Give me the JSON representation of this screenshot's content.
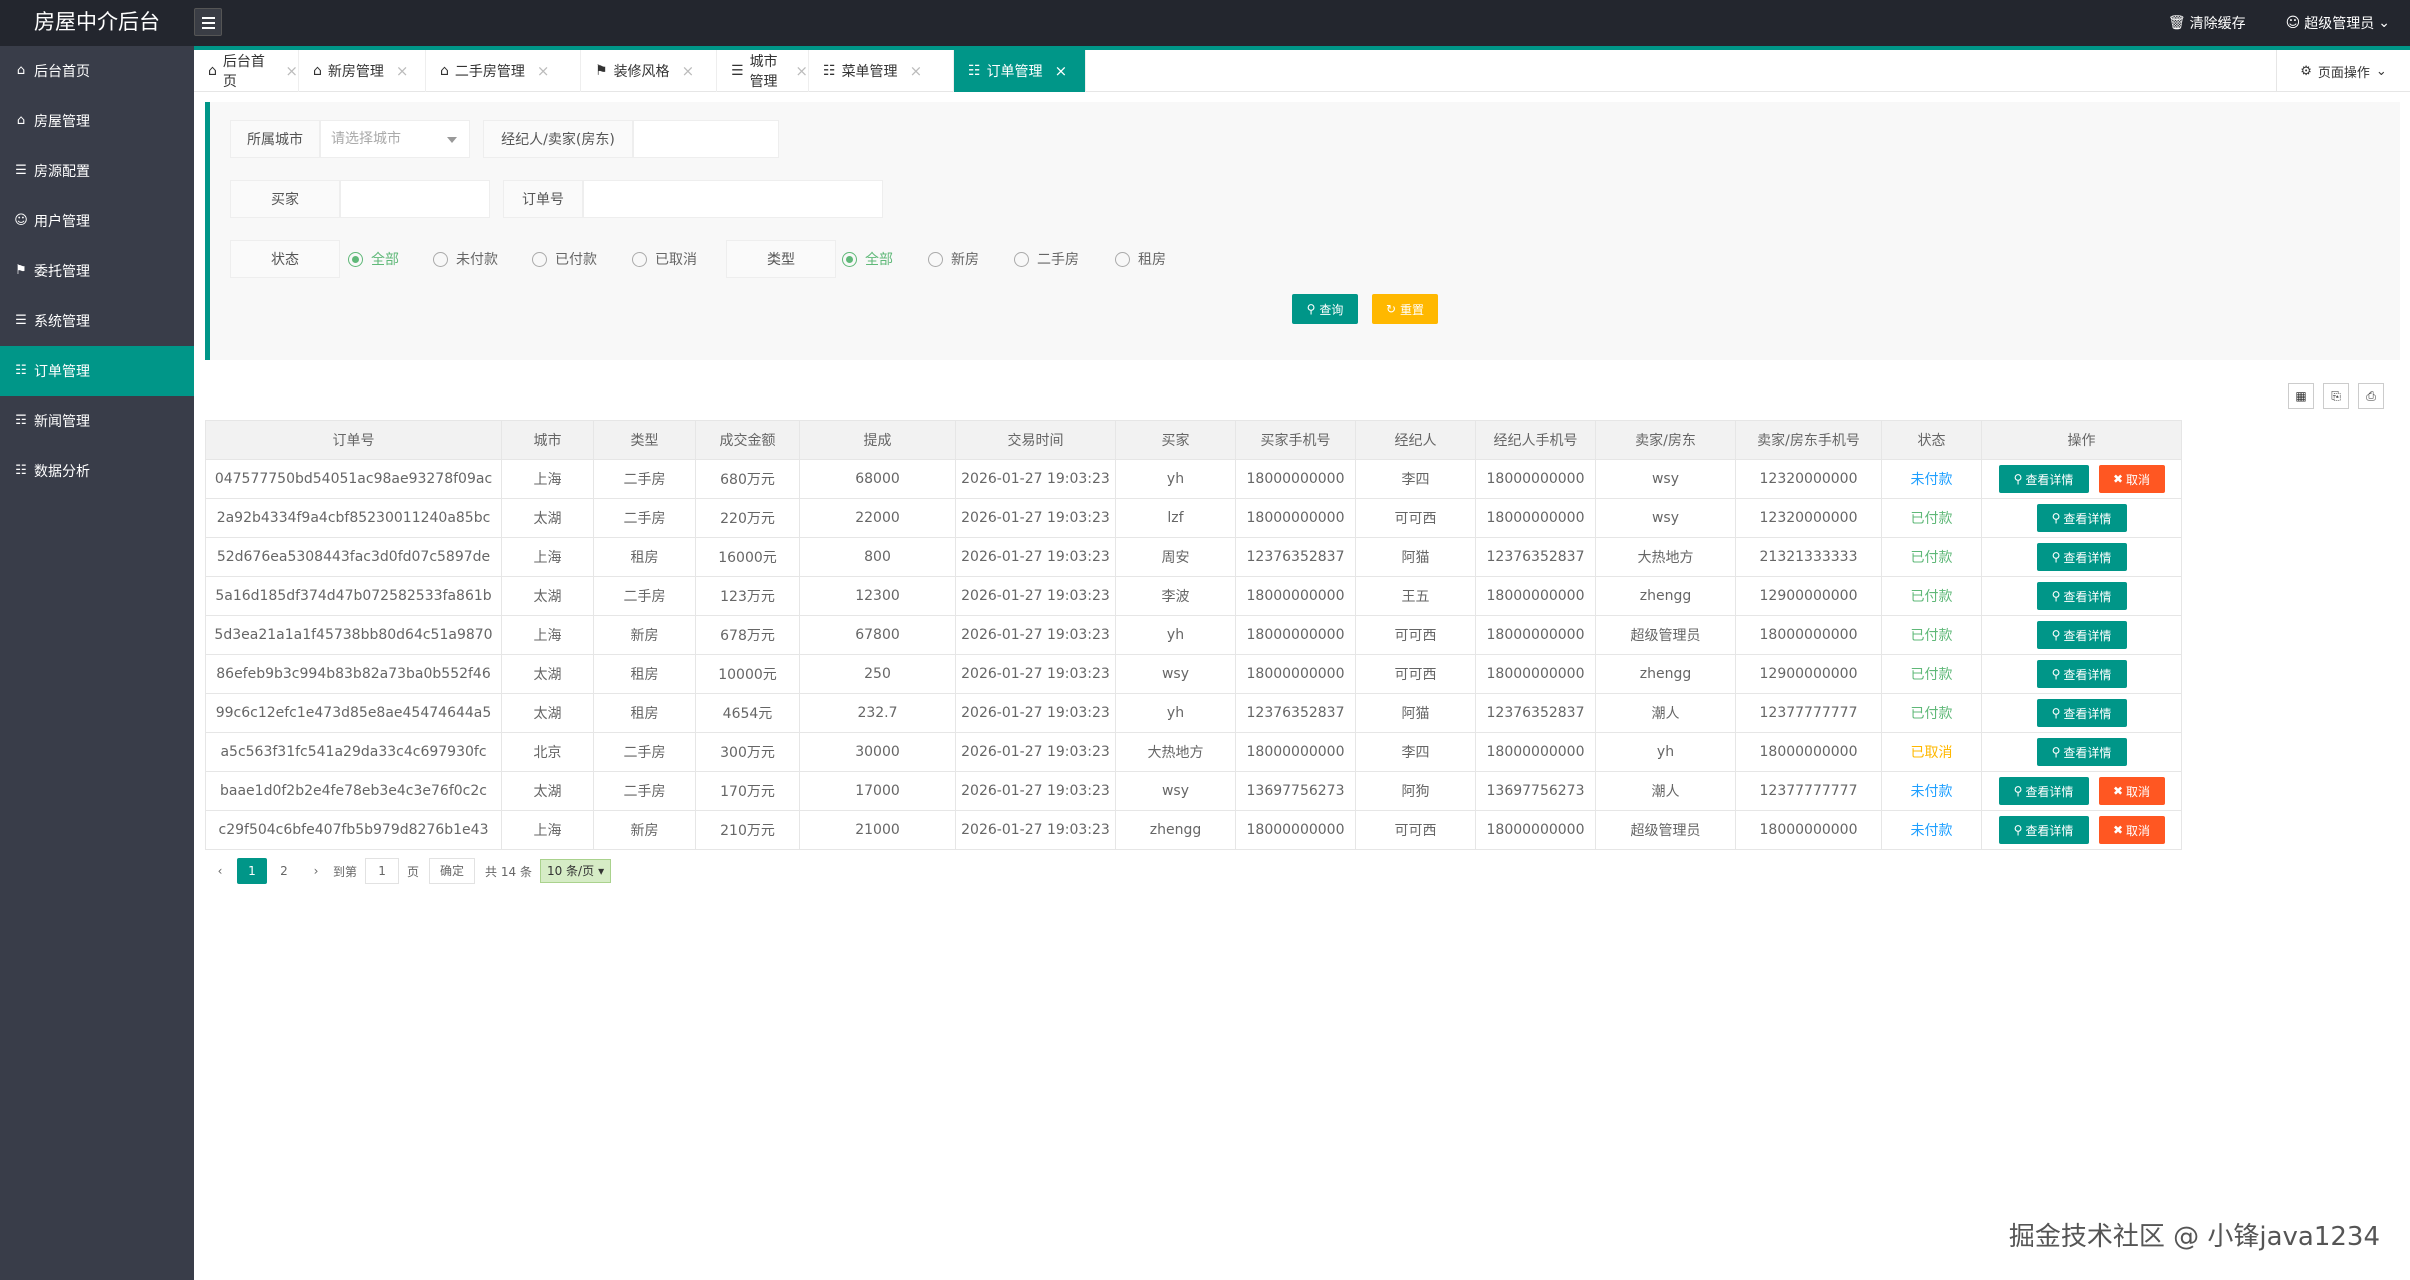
{
  "app": {
    "title": "房屋中介后台"
  },
  "header": {
    "clear_cache": "清除缓存",
    "user": "超级管理员"
  },
  "sidebar": {
    "items": [
      {
        "label": "后台首页",
        "icon": "home-icon"
      },
      {
        "label": "房屋管理",
        "icon": "house-icon"
      },
      {
        "label": "房源配置",
        "icon": "config-icon"
      },
      {
        "label": "用户管理",
        "icon": "user-icon"
      },
      {
        "label": "委托管理",
        "icon": "entrust-icon"
      },
      {
        "label": "系统管理",
        "icon": "system-icon"
      },
      {
        "label": "订单管理",
        "icon": "order-icon",
        "active": true
      },
      {
        "label": "新闻管理",
        "icon": "news-icon"
      },
      {
        "label": "数据分析",
        "icon": "chart-icon"
      }
    ]
  },
  "tabs": [
    {
      "label": "后台首页"
    },
    {
      "label": "新房管理"
    },
    {
      "label": "二手房管理"
    },
    {
      "label": "装修风格"
    },
    {
      "label": "城市管理"
    },
    {
      "label": "菜单管理"
    },
    {
      "label": "订单管理",
      "active": true
    }
  ],
  "page_ops": "页面操作",
  "filters": {
    "city_label": "所属城市",
    "city_placeholder": "请选择城市",
    "agent_label": "经纪人/卖家(房东)",
    "buyer_label": "买家",
    "order_no_label": "订单号",
    "status_label": "状态",
    "status_options": [
      "全部",
      "未付款",
      "已付款",
      "已取消"
    ],
    "status_selected": "全部",
    "type_label": "类型",
    "type_options": [
      "全部",
      "新房",
      "二手房",
      "租房"
    ],
    "type_selected": "全部",
    "query_button": "查询",
    "reset_button": "重置"
  },
  "table": {
    "columns": [
      "订单号",
      "城市",
      "类型",
      "成交金额",
      "提成",
      "交易时间",
      "买家",
      "买家手机号",
      "经纪人",
      "经纪人手机号",
      "卖家/房东",
      "卖家/房东手机号",
      "状态",
      "操作"
    ],
    "view_label": "查看详情",
    "cancel_label": "取消",
    "rows": [
      {
        "order_no": "047577750bd54051ac98ae93278f09ac",
        "city": "上海",
        "type": "二手房",
        "amount": "680万元",
        "commission": "68000",
        "time": "2026-01-27 19:03:23",
        "buyer": "yh",
        "buyer_phone": "18000000000",
        "agent": "李四",
        "agent_phone": "18000000000",
        "seller": "wsy",
        "seller_phone": "12320000000",
        "status": "未付款"
      },
      {
        "order_no": "2a92b4334f9a4cbf85230011240a85bc",
        "city": "太湖",
        "type": "二手房",
        "amount": "220万元",
        "commission": "22000",
        "time": "2026-01-27 19:03:23",
        "buyer": "lzf",
        "buyer_phone": "18000000000",
        "agent": "可可西",
        "agent_phone": "18000000000",
        "seller": "wsy",
        "seller_phone": "12320000000",
        "status": "已付款"
      },
      {
        "order_no": "52d676ea5308443fac3d0fd07c5897de",
        "city": "上海",
        "type": "租房",
        "amount": "16000元",
        "commission": "800",
        "time": "2026-01-27 19:03:23",
        "buyer": "周安",
        "buyer_phone": "12376352837",
        "agent": "阿猫",
        "agent_phone": "12376352837",
        "seller": "大热地方",
        "seller_phone": "21321333333",
        "status": "已付款"
      },
      {
        "order_no": "5a16d185df374d47b072582533fa861b",
        "city": "太湖",
        "type": "二手房",
        "amount": "123万元",
        "commission": "12300",
        "time": "2026-01-27 19:03:23",
        "buyer": "李波",
        "buyer_phone": "18000000000",
        "agent": "王五",
        "agent_phone": "18000000000",
        "seller": "zhengg",
        "seller_phone": "12900000000",
        "status": "已付款"
      },
      {
        "order_no": "5d3ea21a1a1f45738bb80d64c51a9870",
        "city": "上海",
        "type": "新房",
        "amount": "678万元",
        "commission": "67800",
        "time": "2026-01-27 19:03:23",
        "buyer": "yh",
        "buyer_phone": "18000000000",
        "agent": "可可西",
        "agent_phone": "18000000000",
        "seller": "超级管理员",
        "seller_phone": "18000000000",
        "status": "已付款"
      },
      {
        "order_no": "86efeb9b3c994b83b82a73ba0b552f46",
        "city": "太湖",
        "type": "租房",
        "amount": "10000元",
        "commission": "250",
        "time": "2026-01-27 19:03:23",
        "buyer": "wsy",
        "buyer_phone": "18000000000",
        "agent": "可可西",
        "agent_phone": "18000000000",
        "seller": "zhengg",
        "seller_phone": "12900000000",
        "status": "已付款"
      },
      {
        "order_no": "99c6c12efc1e473d85e8ae45474644a5",
        "city": "太湖",
        "type": "租房",
        "amount": "4654元",
        "commission": "232.7",
        "time": "2026-01-27 19:03:23",
        "buyer": "yh",
        "buyer_phone": "12376352837",
        "agent": "阿猫",
        "agent_phone": "12376352837",
        "seller": "潮人",
        "seller_phone": "12377777777",
        "status": "已付款"
      },
      {
        "order_no": "a5c563f31fc541a29da33c4c697930fc",
        "city": "北京",
        "type": "二手房",
        "amount": "300万元",
        "commission": "30000",
        "time": "2026-01-27 19:03:23",
        "buyer": "大热地方",
        "buyer_phone": "18000000000",
        "agent": "李四",
        "agent_phone": "18000000000",
        "seller": "yh",
        "seller_phone": "18000000000",
        "status": "已取消"
      },
      {
        "order_no": "baae1d0f2b2e4fe78eb3e4c3e76f0c2c",
        "city": "太湖",
        "type": "二手房",
        "amount": "170万元",
        "commission": "17000",
        "time": "2026-01-27 19:03:23",
        "buyer": "wsy",
        "buyer_phone": "13697756273",
        "agent": "阿狗",
        "agent_phone": "13697756273",
        "seller": "潮人",
        "seller_phone": "12377777777",
        "status": "未付款"
      },
      {
        "order_no": "c29f504c6bfe407fb5b979d8276b1e43",
        "city": "上海",
        "type": "新房",
        "amount": "210万元",
        "commission": "21000",
        "time": "2026-01-27 19:03:23",
        "buyer": "zhengg",
        "buyer_phone": "18000000000",
        "agent": "可可西",
        "agent_phone": "18000000000",
        "seller": "超级管理员",
        "seller_phone": "18000000000",
        "status": "未付款"
      }
    ]
  },
  "pager": {
    "pages": [
      "1",
      "2"
    ],
    "current": "1",
    "goto_label": "到第",
    "goto_value": "1",
    "page_unit": "页",
    "confirm": "确定",
    "total": "共 14 条",
    "size": "10 条/页"
  },
  "watermark": "掘金技术社区 @ 小锋java1234",
  "colors": {
    "accent": "#009688",
    "topbar": "#23262e",
    "sidebar": "#393d49",
    "warn": "#ffb800",
    "danger": "#ff5722"
  }
}
